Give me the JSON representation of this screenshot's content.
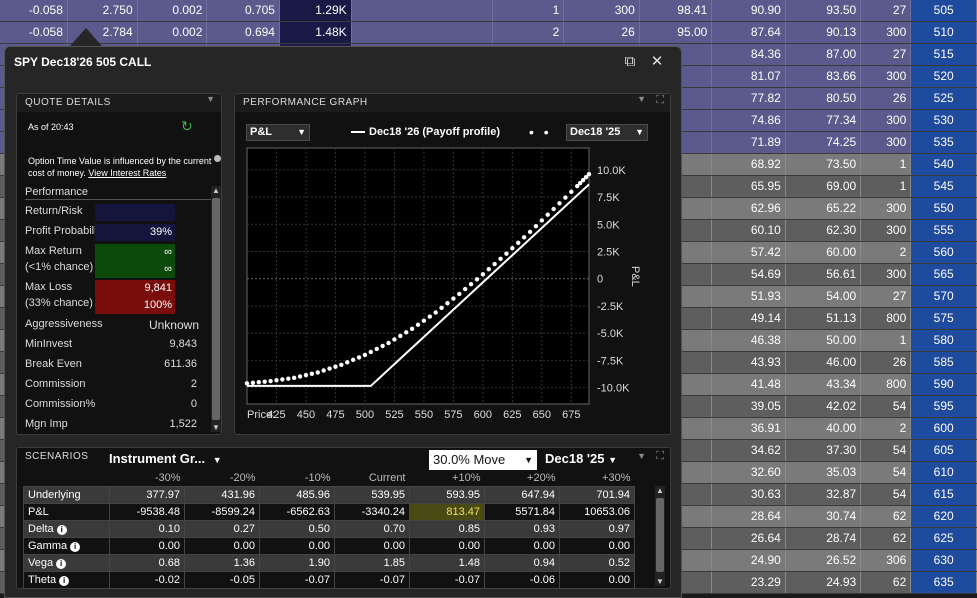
{
  "chain": {
    "rows": [
      {
        "style": "itm",
        "cells": [
          "-0.058",
          "2.750",
          "0.002",
          "0.705",
          "1.29K",
          "1",
          "300",
          "98.41",
          "90.90",
          "93.50",
          "27",
          "505"
        ]
      },
      {
        "style": "itm",
        "cells": [
          "-0.058",
          "2.784",
          "0.002",
          "0.694",
          "1.48K",
          "2",
          "26",
          "95.00",
          "87.64",
          "90.13",
          "300",
          "510"
        ]
      },
      {
        "style": "itm",
        "cells": [
          "",
          "",
          "",
          "",
          "",
          "",
          "",
          "",
          "84.36",
          "87.00",
          "27",
          "515"
        ]
      },
      {
        "style": "itm",
        "cells": [
          "",
          "",
          "",
          "",
          "",
          "",
          "",
          "",
          "81.07",
          "83.66",
          "300",
          "520"
        ]
      },
      {
        "style": "itm",
        "cells": [
          "",
          "",
          "",
          "",
          "",
          "",
          "",
          "",
          "77.82",
          "80.50",
          "26",
          "525"
        ]
      },
      {
        "style": "itm",
        "cells": [
          "",
          "",
          "",
          "",
          "",
          "",
          "",
          "",
          "74.86",
          "77.34",
          "300",
          "530"
        ]
      },
      {
        "style": "itm",
        "cells": [
          "",
          "",
          "",
          "",
          "",
          "",
          "",
          "",
          "71.89",
          "74.25",
          "300",
          "535"
        ]
      },
      {
        "style": "a",
        "cells": [
          "",
          "",
          "",
          "",
          "",
          "",
          "",
          "",
          "68.92",
          "73.50",
          "1",
          "540"
        ]
      },
      {
        "style": "b",
        "cells": [
          "",
          "",
          "",
          "",
          "",
          "",
          "",
          "",
          "65.95",
          "69.00",
          "1",
          "545"
        ]
      },
      {
        "style": "a",
        "cells": [
          "",
          "",
          "",
          "",
          "",
          "",
          "",
          "",
          "62.96",
          "65.22",
          "300",
          "550"
        ]
      },
      {
        "style": "b",
        "cells": [
          "",
          "",
          "",
          "",
          "",
          "",
          "",
          "",
          "60.10",
          "62.30",
          "300",
          "555"
        ]
      },
      {
        "style": "a",
        "cells": [
          "",
          "",
          "",
          "",
          "",
          "",
          "",
          "",
          "57.42",
          "60.00",
          "2",
          "560"
        ]
      },
      {
        "style": "b",
        "cells": [
          "",
          "",
          "",
          "",
          "",
          "",
          "",
          "",
          "54.69",
          "56.61",
          "300",
          "565"
        ]
      },
      {
        "style": "a",
        "cells": [
          "",
          "",
          "",
          "",
          "",
          "",
          "",
          "",
          "51.93",
          "54.00",
          "27",
          "570"
        ]
      },
      {
        "style": "b",
        "cells": [
          "",
          "",
          "",
          "",
          "",
          "",
          "",
          "",
          "49.14",
          "51.13",
          "800",
          "575"
        ]
      },
      {
        "style": "a",
        "cells": [
          "",
          "",
          "",
          "",
          "",
          "",
          "",
          "",
          "46.38",
          "50.00",
          "1",
          "580"
        ]
      },
      {
        "style": "b",
        "cells": [
          "",
          "",
          "",
          "",
          "",
          "",
          "",
          "",
          "43.93",
          "46.00",
          "26",
          "585"
        ]
      },
      {
        "style": "a",
        "cells": [
          "",
          "",
          "",
          "",
          "",
          "",
          "",
          "",
          "41.48",
          "43.34",
          "800",
          "590"
        ]
      },
      {
        "style": "b",
        "cells": [
          "",
          "",
          "",
          "",
          "",
          "",
          "",
          "",
          "39.05",
          "42.02",
          "54",
          "595"
        ]
      },
      {
        "style": "a",
        "cells": [
          "",
          "",
          "",
          "",
          "",
          "",
          "",
          "",
          "36.91",
          "40.00",
          "2",
          "600"
        ]
      },
      {
        "style": "b",
        "cells": [
          "",
          "",
          "",
          "",
          "",
          "",
          "",
          "",
          "34.62",
          "37.30",
          "54",
          "605"
        ]
      },
      {
        "style": "a",
        "cells": [
          "",
          "",
          "",
          "",
          "",
          "",
          "",
          "",
          "32.60",
          "35.03",
          "54",
          "610"
        ]
      },
      {
        "style": "b",
        "cells": [
          "",
          "",
          "",
          "",
          "",
          "",
          "",
          "",
          "30.63",
          "32.87",
          "54",
          "615"
        ]
      },
      {
        "style": "a",
        "cells": [
          "",
          "",
          "",
          "",
          "",
          "",
          "",
          "",
          "28.64",
          "30.74",
          "62",
          "620"
        ]
      },
      {
        "style": "b",
        "cells": [
          "",
          "",
          "",
          "",
          "",
          "",
          "",
          "",
          "26.64",
          "28.74",
          "62",
          "625"
        ]
      },
      {
        "style": "a",
        "cells": [
          "",
          "",
          "",
          "",
          "",
          "",
          "",
          "",
          "24.90",
          "26.52",
          "306",
          "630"
        ]
      },
      {
        "style": "b",
        "cells": [
          "",
          "",
          "",
          "",
          "",
          "",
          "",
          "",
          "23.29",
          "24.93",
          "62",
          "635"
        ]
      }
    ]
  },
  "popup": {
    "title": "SPY Dec18'26 505 CALL",
    "quote": {
      "header": "QUOTE DETAILS",
      "as_of": "As of 20:43",
      "note": "Option Time Value is influenced by the current cost of money.",
      "note_link": "View Interest Rates",
      "perf_header": "Performance",
      "return_risk_label": "Return/Risk",
      "profit_prob_label": "Profit Probability",
      "profit_prob": "39%",
      "max_return_label": "Max Return",
      "max_return_sub": "(<1% chance)",
      "max_return": "∞",
      "max_return_pct": "∞",
      "max_loss_label": "Max Loss",
      "max_loss_sub": "(33% chance)",
      "max_loss": "9,841",
      "max_loss_pct": "100%",
      "aggr_label": "Aggressiveness",
      "aggr": "Unknown",
      "mininvest_label": "MinInvest",
      "mininvest": "9,843",
      "breakeven_label": "Break Even",
      "breakeven": "611.36",
      "commission_label": "Commission",
      "commission": "2",
      "commission_pct_label": "Commission%",
      "commission_pct": "0",
      "mgn_label": "Mgn Imp",
      "mgn": "1,522"
    },
    "graph": {
      "header": "PERFORMANCE GRAPH",
      "metric": "P&L",
      "series1_label": "Dec18 '26 (Payoff profile)",
      "series2_label": "Dec18 '25",
      "price_label": "Price:"
    },
    "scenarios": {
      "header": "SCENARIOS",
      "group": "Instrument Gr...",
      "move": "30.0% Move",
      "date": "Dec18 '25",
      "columns": [
        "-30%",
        "-20%",
        "-10%",
        "Current",
        "+10%",
        "+20%",
        "+30%"
      ],
      "rows": [
        {
          "label": "Underlying",
          "info": false,
          "values": [
            "377.97",
            "431.96",
            "485.96",
            "539.95",
            "593.95",
            "647.94",
            "701.94"
          ]
        },
        {
          "label": "P&L",
          "info": false,
          "values": [
            "-9538.48",
            "-8599.24",
            "-6562.63",
            "-3340.24",
            "813.47",
            "5571.84",
            "10653.06"
          ]
        },
        {
          "label": "Delta",
          "info": true,
          "values": [
            "0.10",
            "0.27",
            "0.50",
            "0.70",
            "0.85",
            "0.93",
            "0.97"
          ]
        },
        {
          "label": "Gamma",
          "info": true,
          "values": [
            "0.00",
            "0.00",
            "0.00",
            "0.00",
            "0.00",
            "0.00",
            "0.00"
          ]
        },
        {
          "label": "Vega",
          "info": true,
          "values": [
            "0.68",
            "1.36",
            "1.90",
            "1.85",
            "1.48",
            "0.94",
            "0.52"
          ]
        },
        {
          "label": "Theta",
          "info": true,
          "values": [
            "-0.02",
            "-0.05",
            "-0.07",
            "-0.07",
            "-0.07",
            "-0.06",
            "0.00"
          ]
        }
      ]
    }
  },
  "chart_data": {
    "type": "line",
    "xlabel": "Price:",
    "ylabel": "P&L",
    "x_ticks": [
      425,
      450,
      475,
      500,
      525,
      550,
      575,
      600,
      625,
      650,
      675
    ],
    "y_ticks": [
      10000,
      7500,
      5000,
      2500,
      0,
      -2500,
      -5000,
      -7500,
      -10000
    ],
    "y_tick_labels": [
      "10.0K",
      "7.5K",
      "5.0K",
      "2.5K",
      "0",
      "-2.5K",
      "-5.0K",
      "-7.5K",
      "-10.0K"
    ],
    "xlim": [
      400,
      690
    ],
    "ylim": [
      -11500,
      12000
    ],
    "series": [
      {
        "name": "Dec18 '26 (Payoff profile)",
        "style": "solid",
        "x": [
          400,
          505,
          690
        ],
        "y": [
          -9841,
          -9841,
          8659
        ]
      },
      {
        "name": "Dec18 '25",
        "style": "dotted",
        "x": [
          400,
          420,
          440,
          460,
          480,
          500,
          520,
          540,
          560,
          580,
          600,
          620,
          640,
          660,
          680,
          690
        ],
        "y": [
          -9600,
          -9400,
          -9100,
          -8600,
          -7900,
          -7000,
          -5900,
          -4600,
          -3100,
          -1400,
          400,
          2300,
          4300,
          6400,
          8500,
          9600
        ]
      }
    ]
  }
}
